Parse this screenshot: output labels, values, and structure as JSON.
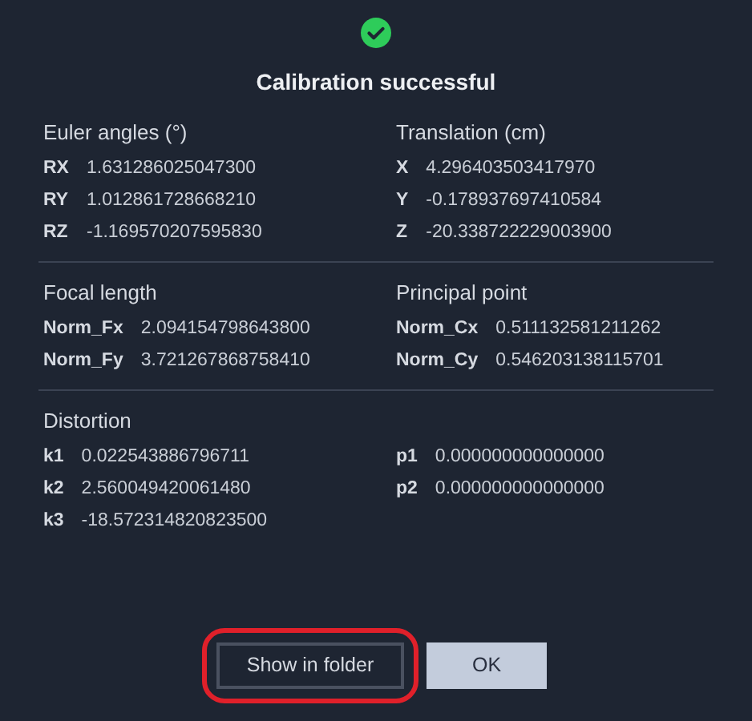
{
  "status": {
    "kind": "success",
    "title": "Calibration successful"
  },
  "sections": [
    {
      "groups": [
        {
          "heading": "Euler angles (°)",
          "rows": [
            {
              "label": "RX",
              "value": "1.631286025047300"
            },
            {
              "label": "RY",
              "value": "1.012861728668210"
            },
            {
              "label": "RZ",
              "value": "-1.169570207595830"
            }
          ]
        },
        {
          "heading": "Translation (cm)",
          "rows": [
            {
              "label": "X",
              "value": "4.296403503417970"
            },
            {
              "label": "Y",
              "value": "-0.178937697410584"
            },
            {
              "label": "Z",
              "value": "-20.338722229003900"
            }
          ]
        }
      ]
    },
    {
      "groups": [
        {
          "heading": "Focal length",
          "rows": [
            {
              "label": "Norm_Fx",
              "value": "2.094154798643800"
            },
            {
              "label": "Norm_Fy",
              "value": "3.721267868758410"
            }
          ]
        },
        {
          "heading": "Principal point",
          "rows": [
            {
              "label": "Norm_Cx",
              "value": "0.511132581211262"
            },
            {
              "label": "Norm_Cy",
              "value": "0.546203138115701"
            }
          ]
        }
      ]
    },
    {
      "heading": "Distortion",
      "groups": [
        {
          "rows": [
            {
              "label": "k1",
              "value": "0.022543886796711"
            },
            {
              "label": "k2",
              "value": "2.560049420061480"
            },
            {
              "label": "k3",
              "value": "-18.572314820823500"
            }
          ]
        },
        {
          "rows": [
            {
              "label": "p1",
              "value": "0.000000000000000"
            },
            {
              "label": "p2",
              "value": "0.000000000000000"
            }
          ]
        }
      ]
    }
  ],
  "buttons": [
    {
      "label": "Show in folder",
      "kind": "outline",
      "highlighted": true
    },
    {
      "label": "OK",
      "kind": "primary",
      "highlighted": false
    }
  ]
}
